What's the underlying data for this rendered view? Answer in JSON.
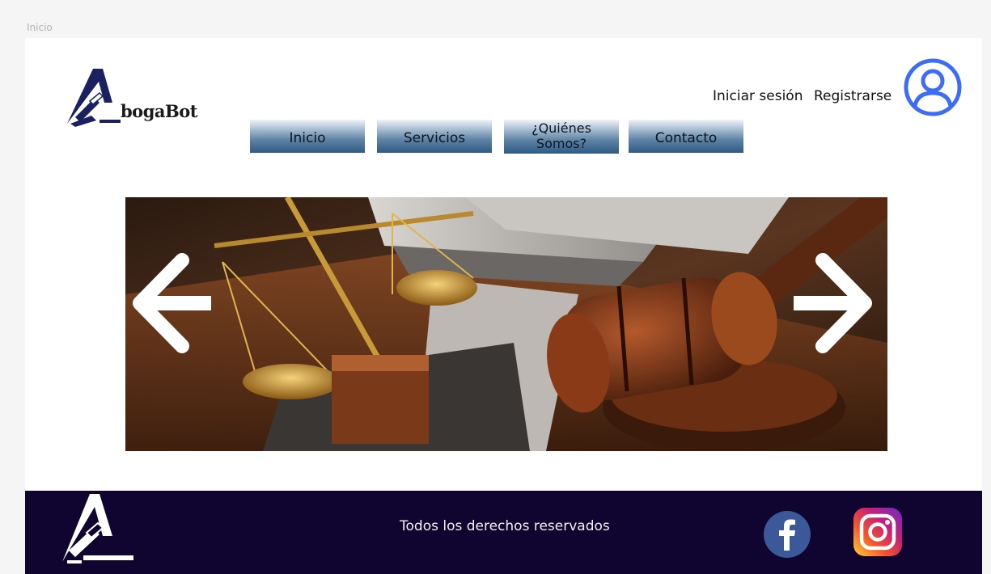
{
  "frame_label": "Inicio",
  "brand": {
    "logo_text": "bogaBot"
  },
  "header": {
    "login_label": "Iniciar sesión",
    "register_label": "Registrarse"
  },
  "nav": {
    "items": [
      {
        "label": "Inicio"
      },
      {
        "label": "Servicios"
      },
      {
        "label_line1": "¿Quiénes",
        "label_line2": "Somos?"
      },
      {
        "label": "Contacto"
      }
    ]
  },
  "footer": {
    "copyright": "Todos los derechos reservados"
  },
  "colors": {
    "footer_bg": "#0f0530",
    "avatar_blue": "#3d6df2",
    "facebook_blue": "#3b5998",
    "nav_dark": "#2e5a82"
  },
  "icons": {
    "avatar": "user-circle-icon",
    "prev": "arrow-left-icon",
    "next": "arrow-right-icon",
    "facebook": "facebook-icon",
    "instagram": "instagram-icon"
  }
}
